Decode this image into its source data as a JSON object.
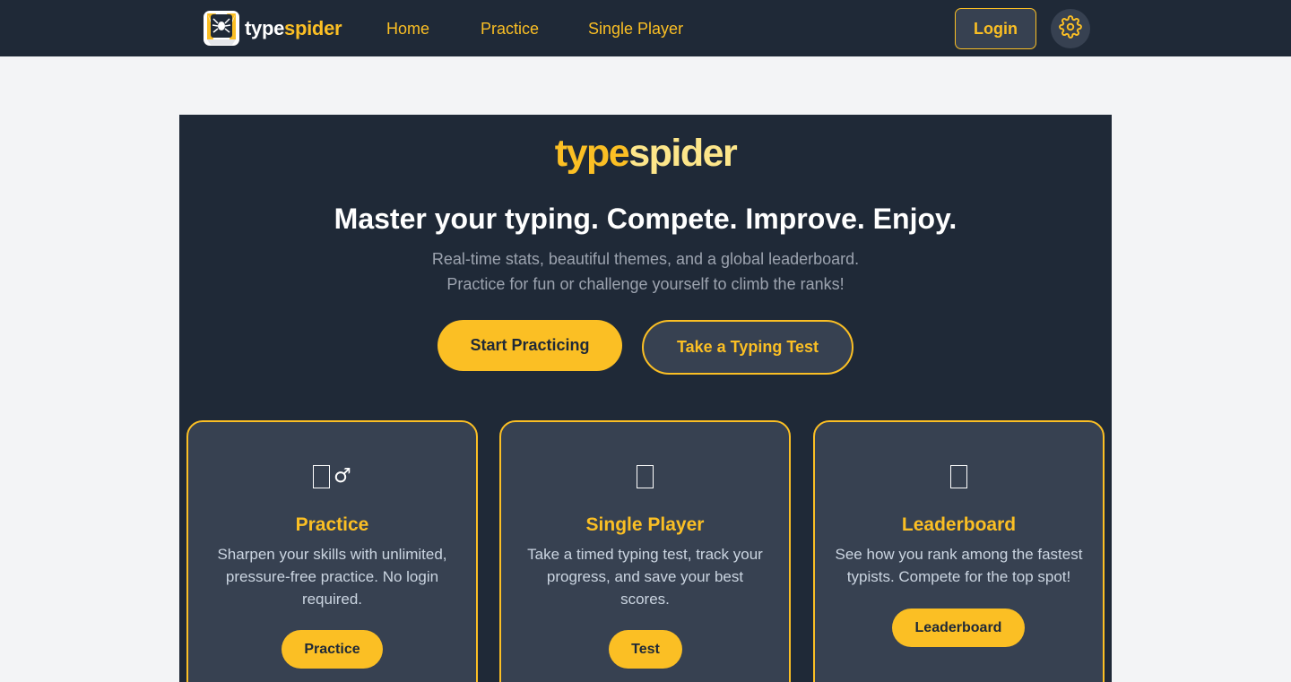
{
  "navbar": {
    "logo_text_part1": "type",
    "logo_text_part2": "spider",
    "links": [
      "Home",
      "Practice",
      "Single Player"
    ],
    "login_label": "Login",
    "settings_icon": "gear-icon"
  },
  "hero": {
    "brand_part1": "type",
    "brand_part2": "spider",
    "headline": "Master your typing. Compete. Improve. Enjoy.",
    "sub_line1": "Real-time stats, beautiful themes, and a global leaderboard.",
    "sub_line2": "Practice for fun or challenge yourself to climb the ranks!",
    "primary_cta": "Start Practicing",
    "secondary_cta": "Take a Typing Test"
  },
  "cards": [
    {
      "icon": "person-running-icon",
      "icon_text": "♂",
      "title": "Practice",
      "desc_lines": [
        "Sharpen your skills with unlimited,",
        "pressure-free practice. No login",
        "required."
      ],
      "button": "Practice"
    },
    {
      "icon": "stopwatch-icon",
      "title": "Single Player",
      "desc_lines": [
        "Take a timed typing test, track your",
        "progress, and save your best",
        "scores."
      ],
      "button": "Test"
    },
    {
      "icon": "trophy-icon",
      "title": "Leaderboard",
      "desc_lines": [
        "See how you rank among the fastest",
        "typists. Compete for the top spot!"
      ],
      "button": "Leaderboard"
    }
  ],
  "colors": {
    "navy": "#1f2937",
    "slate": "#374151",
    "accent": "#fbbf24",
    "page_bg": "#f3f4f6"
  }
}
